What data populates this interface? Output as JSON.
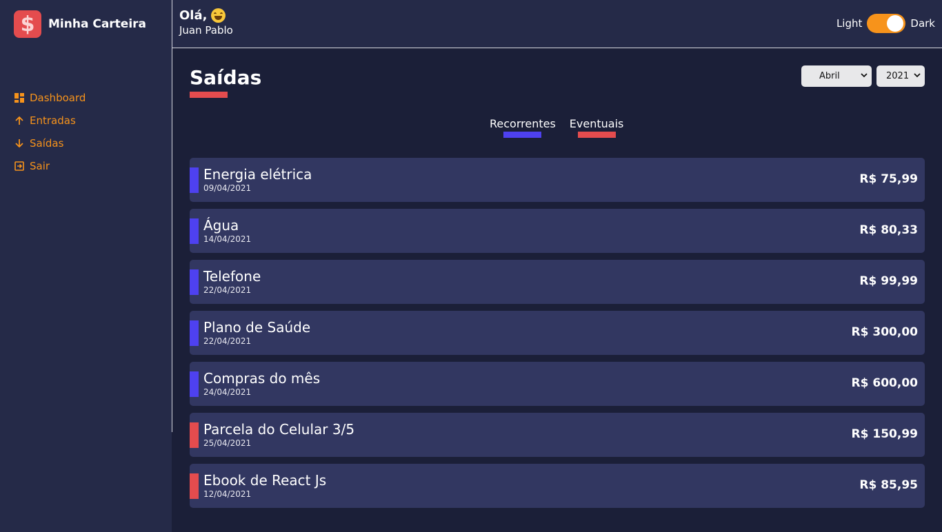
{
  "app": {
    "name": "Minha Carteira",
    "logo_symbol": "$"
  },
  "colors": {
    "accent": "#f7931b",
    "recurrent": "#4e41f0",
    "eventual": "#e44c4e",
    "background": "#1b1f38",
    "panel": "#252a48",
    "card": "#323761"
  },
  "sidebar": {
    "items": [
      {
        "label": "Dashboard",
        "icon": "dashboard-icon"
      },
      {
        "label": "Entradas",
        "icon": "arrow-up-icon"
      },
      {
        "label": "Saídas",
        "icon": "arrow-down-icon"
      },
      {
        "label": "Sair",
        "icon": "exit-icon"
      }
    ]
  },
  "header": {
    "greeting": "Olá,",
    "emoji": "grinning-face-icon",
    "user_name": "Juan Pablo",
    "theme_light": "Light",
    "theme_dark": "Dark"
  },
  "page": {
    "title": "Saídas",
    "month": "Abril",
    "year": "2021"
  },
  "tabs": [
    {
      "label": "Recorrentes",
      "color": "#4e41f0"
    },
    {
      "label": "Eventuais",
      "color": "#e44c4e"
    }
  ],
  "transactions": [
    {
      "title": "Energia elétrica",
      "date": "09/04/2021",
      "amount": "R$ 75,99",
      "type": "recurrent"
    },
    {
      "title": "Água",
      "date": "14/04/2021",
      "amount": "R$ 80,33",
      "type": "recurrent"
    },
    {
      "title": "Telefone",
      "date": "22/04/2021",
      "amount": "R$ 99,99",
      "type": "recurrent"
    },
    {
      "title": "Plano de Saúde",
      "date": "22/04/2021",
      "amount": "R$ 300,00",
      "type": "recurrent"
    },
    {
      "title": "Compras do mês",
      "date": "24/04/2021",
      "amount": "R$ 600,00",
      "type": "recurrent"
    },
    {
      "title": "Parcela do Celular 3/5",
      "date": "25/04/2021",
      "amount": "R$ 150,99",
      "type": "eventual"
    },
    {
      "title": "Ebook de React Js",
      "date": "12/04/2021",
      "amount": "R$ 85,95",
      "type": "eventual"
    }
  ]
}
